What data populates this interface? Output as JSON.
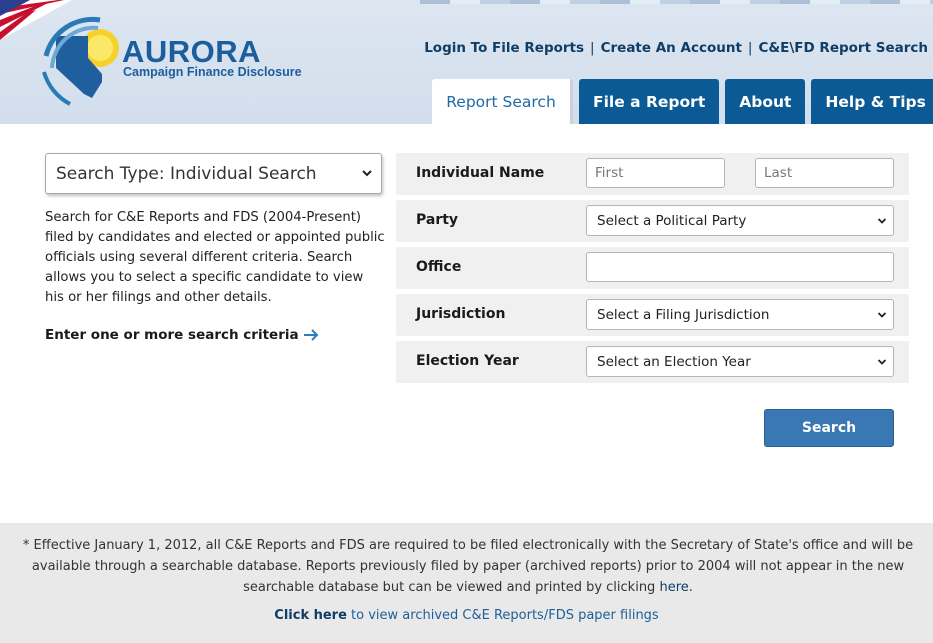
{
  "header": {
    "logo_title": "AURORA",
    "logo_subtitle": "Campaign Finance Disclosure",
    "top_links": [
      {
        "label": "Login To File Reports"
      },
      {
        "label": "Create An Account"
      },
      {
        "label": "C&E\\FD Report Search"
      }
    ],
    "separator": "|",
    "tabs": [
      {
        "label": "Report Search",
        "active": true
      },
      {
        "label": "File a Report",
        "active": false
      },
      {
        "label": "About",
        "active": false
      },
      {
        "label": "Help & Tips",
        "active": false
      }
    ]
  },
  "left": {
    "search_type_value": "Search Type: Individual Search",
    "description": "Search for C&E Reports and FDS (2004-Present) filed by candidates and elected or appointed public officials using several different criteria. Search allows you to select a specific candidate to view his or her filings and other details.",
    "enter_criteria": "Enter one or more search criteria"
  },
  "form": {
    "individual_name_label": "Individual Name",
    "first_placeholder": "First",
    "last_placeholder": "Last",
    "party_label": "Party",
    "party_value": "Select a Political Party",
    "office_label": "Office",
    "office_value": "",
    "jurisdiction_label": "Jurisdiction",
    "jurisdiction_value": "Select a Filing Jurisdiction",
    "election_year_label": "Election Year",
    "election_year_value": "Select an Election Year",
    "search_button": "Search"
  },
  "footer": {
    "note_before": "* Effective January 1, 2012, all C&E Reports and FDS are required to be filed electronically with the Secretary of State's office and will be available through a searchable database. Reports previously filed by paper (archived reports) prior to 2004 will not appear in the new searchable database but can be viewed and printed by clicking ",
    "note_link": "here",
    "note_after": ".",
    "archive_link_bold": "Click here",
    "archive_link_rest": " to view archived C&E Reports/FDS paper filings"
  },
  "colors": {
    "brand_blue": "#0b5a96",
    "link_navy": "#0f3d66",
    "button_blue": "#3a78b4"
  }
}
